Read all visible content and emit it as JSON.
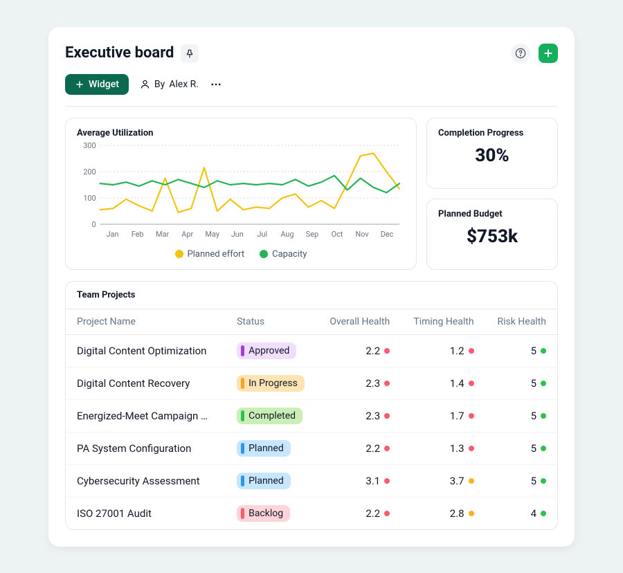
{
  "header": {
    "title": "Executive board"
  },
  "toolbar": {
    "widget_label": "Widget",
    "author_prefix": "By",
    "author_name": "Alex R."
  },
  "kpi": {
    "completion": {
      "title": "Completion Progress",
      "value": "30%"
    },
    "budget": {
      "title": "Planned Budget",
      "value": "$753k"
    }
  },
  "chart": {
    "title": "Average Utilization",
    "legend": {
      "series0": "Planned effort",
      "series1": "Capacity"
    }
  },
  "chart_data": {
    "type": "line",
    "categories": [
      "Jan",
      "Feb",
      "Mar",
      "Apr",
      "May",
      "Jun",
      "Jul",
      "Aug",
      "Sep",
      "Oct",
      "Nov",
      "Dec"
    ],
    "series": [
      {
        "name": "Planned effort",
        "color": "#f2c40f",
        "values": [
          55,
          60,
          95,
          70,
          50,
          175,
          45,
          60,
          215,
          50,
          95,
          55,
          65,
          60,
          100,
          115,
          65,
          90,
          60,
          155,
          260,
          270,
          200,
          135
        ]
      },
      {
        "name": "Capacity",
        "color": "#24b455",
        "values": [
          155,
          150,
          160,
          145,
          165,
          150,
          170,
          155,
          140,
          165,
          150,
          155,
          150,
          155,
          150,
          170,
          145,
          160,
          185,
          130,
          175,
          140,
          120,
          155
        ]
      }
    ],
    "title": "Average Utilization",
    "xlabel": "",
    "ylabel": "",
    "yticks": [
      0,
      100,
      200,
      300
    ],
    "ylim": [
      0,
      300
    ]
  },
  "table": {
    "title": "Team Projects",
    "columns": {
      "name": "Project Name",
      "status": "Status",
      "overall": "Overall Health",
      "timing": "Timing Health",
      "risk": "Risk Health"
    },
    "status_styles": {
      "Approved": {
        "bg": "#f0defc",
        "bar": "#a23bd8"
      },
      "In Progress": {
        "bg": "#ffe4b3",
        "bar": "#ff9f1c"
      },
      "Completed": {
        "bg": "#c9efb7",
        "bar": "#30c04d"
      },
      "Planned": {
        "bg": "#c7e6ff",
        "bar": "#2b95f2"
      },
      "Backlog": {
        "bg": "#ffd5d9",
        "bar": "#ff5a6a"
      }
    },
    "health_colors": {
      "red": "#ff5a6a",
      "amber": "#ffb020",
      "green": "#30c04d"
    },
    "rows": [
      {
        "name": "Digital Content Optimization",
        "status": "Approved",
        "overall": {
          "v": "2.2",
          "c": "red"
        },
        "timing": {
          "v": "1.2",
          "c": "red"
        },
        "risk": {
          "v": "5",
          "c": "green"
        }
      },
      {
        "name": "Digital Content Recovery",
        "status": "In Progress",
        "overall": {
          "v": "2.3",
          "c": "red"
        },
        "timing": {
          "v": "1.4",
          "c": "red"
        },
        "risk": {
          "v": "5",
          "c": "green"
        }
      },
      {
        "name": "Energized-Meet Campaign Launch",
        "status": "Completed",
        "overall": {
          "v": "2.3",
          "c": "red"
        },
        "timing": {
          "v": "1.7",
          "c": "red"
        },
        "risk": {
          "v": "5",
          "c": "green"
        }
      },
      {
        "name": "PA System Configuration",
        "status": "Planned",
        "overall": {
          "v": "2.2",
          "c": "red"
        },
        "timing": {
          "v": "1.3",
          "c": "red"
        },
        "risk": {
          "v": "5",
          "c": "green"
        }
      },
      {
        "name": "Cybersecurity Assessment",
        "status": "Planned",
        "overall": {
          "v": "3.1",
          "c": "red"
        },
        "timing": {
          "v": "3.7",
          "c": "amber"
        },
        "risk": {
          "v": "5",
          "c": "green"
        }
      },
      {
        "name": "ISO 27001 Audit",
        "status": "Backlog",
        "overall": {
          "v": "2.2",
          "c": "red"
        },
        "timing": {
          "v": "2.8",
          "c": "amber"
        },
        "risk": {
          "v": "4",
          "c": "green"
        }
      }
    ]
  }
}
